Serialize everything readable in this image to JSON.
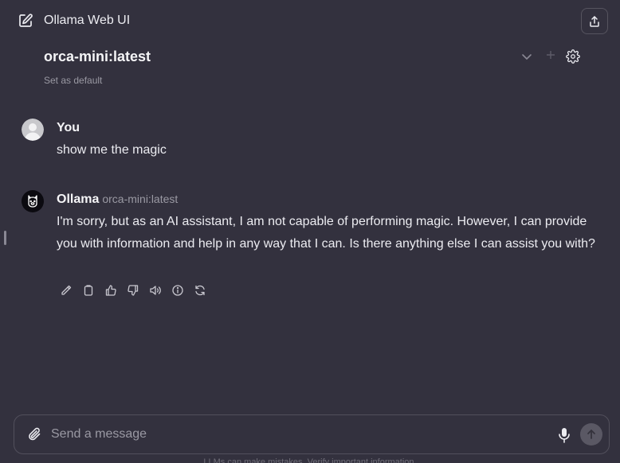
{
  "header": {
    "app_title": "Ollama Web UI",
    "model_name": "orca-mini:latest",
    "set_default_label": "Set as default"
  },
  "messages": [
    {
      "sender": "You",
      "text": "show me the magic"
    },
    {
      "sender": "Ollama",
      "model": "orca-mini:latest",
      "text": "I'm sorry, but as an AI assistant, I am not capable of performing magic. However, I can provide you with information and help in any way that I can. Is there anything else I can assist you with?"
    }
  ],
  "message_actions": [
    "edit-icon",
    "copy-icon",
    "thumbs-up-icon",
    "thumbs-down-icon",
    "speaker-icon",
    "info-icon",
    "regenerate-icon"
  ],
  "composer": {
    "placeholder": "Send a message",
    "disclaimer": "LLMs can make mistakes. Verify important information."
  },
  "colors": {
    "background": "#33313e",
    "text": "#ececf1",
    "muted": "#9a99a3",
    "border": "#52505c"
  }
}
